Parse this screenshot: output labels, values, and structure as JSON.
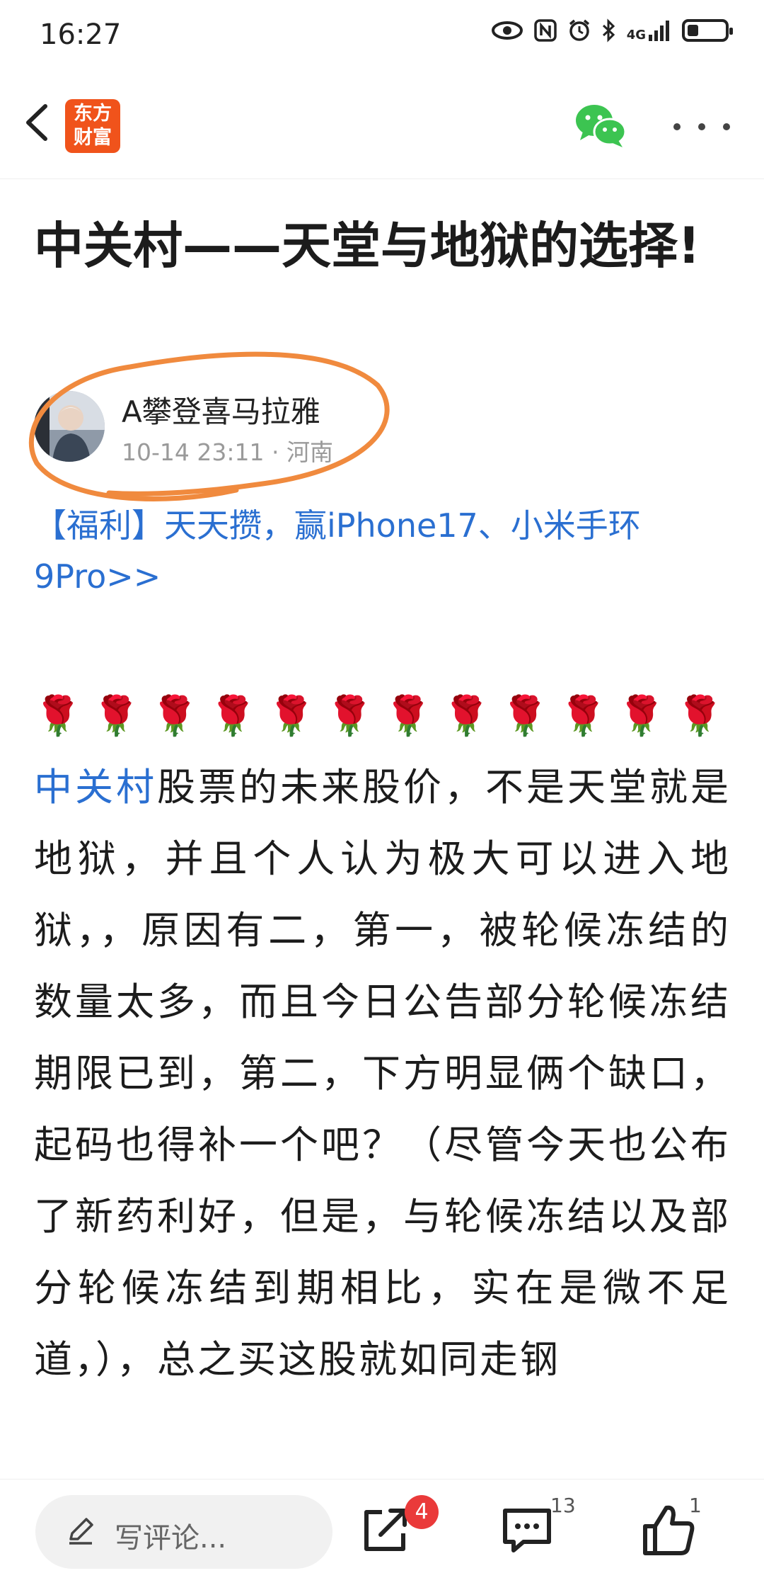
{
  "status_bar": {
    "time": "16:27",
    "network": "4G",
    "battery_level": 0.3,
    "icons": [
      "eye-icon",
      "nfc-icon",
      "alarm-icon",
      "bluetooth-icon",
      "signal-icon",
      "battery-icon"
    ]
  },
  "header": {
    "logo_line1": "东方",
    "logo_line2": "财富",
    "logo_color": "#f0531b",
    "share_icon": "wechat-icon",
    "more_icon": "more-icon"
  },
  "article": {
    "title": "中关村——天堂与地狱的选择!",
    "author": {
      "name": "A攀登喜马拉雅",
      "meta": "10-14 23:11 · 河南"
    },
    "promo_link": "【福利】天天攒，赢iPhone17、小米手环9Pro>>",
    "roses": "🌹🌹🌹🌹🌹🌹🌹🌹🌹🌹🌹🌹",
    "stock_link": "中关村",
    "body": "股票的未来股价，不是天堂就是地狱，并且个人认为极大可以进入地狱，，原因有二，第一，被轮候冻结的数量太多，而且今日公告部分轮候冻结期限已到，第二，下方明显俩个缺口，起码也得补一个吧？（尽管今天也公布了新药利好，但是，与轮候冻结以及部分轮候冻结到期相比，实在是微不足道，），总之买这股就如同走钢"
  },
  "bottom_bar": {
    "comment_placeholder": "写评论...",
    "share_badge": "4",
    "comment_count": "13",
    "like_count": "1"
  },
  "colors": {
    "link": "#2a6fd1",
    "badge": "#ea3a3a",
    "annotation": "#f08a3e"
  }
}
